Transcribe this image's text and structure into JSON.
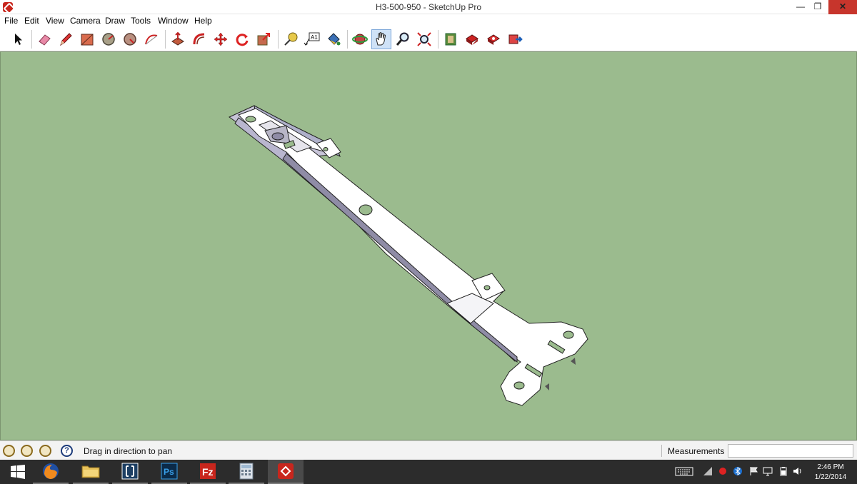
{
  "window": {
    "title": "H3-500-950 - SketchUp Pro",
    "min_glyph": "—",
    "max_glyph": "❐",
    "close_glyph": "✕"
  },
  "menu": [
    "File",
    "Edit",
    "View",
    "Camera",
    "Draw",
    "Tools",
    "Window",
    "Help"
  ],
  "toolbar": {
    "active_tool": "pan-icon",
    "dimension_tool_text": "A1",
    "tools": [
      "select-icon",
      "eraser-icon",
      "pencil-icon",
      "rectangle-icon",
      "circle-icon",
      "polygon-icon",
      "arc-icon",
      "push-pull-icon",
      "follow-me-icon",
      "move-icon",
      "rotate-icon",
      "scale-icon",
      "tape-measure-icon",
      "dimension-text-icon",
      "paint-bucket-icon",
      "orbit-icon",
      "pan-icon",
      "zoom-icon",
      "zoom-extents-icon",
      "3d-warehouse-icon",
      "share-model-icon",
      "get-models-icon",
      "extension-warehouse-icon"
    ]
  },
  "viewport": {
    "background_color": "#9bbb8e",
    "model": "bracket-model"
  },
  "statusbar": {
    "hint": "Drag in direction to pan",
    "measurements_label": "Measurements",
    "measurements_value": "",
    "icons": [
      "geo-location-icon",
      "credits-icon",
      "sign-in-icon",
      "help-icon"
    ]
  },
  "taskbar": {
    "apps": [
      "windows-start-icon",
      "firefox-icon",
      "file-explorer-icon",
      "app-icon",
      "photoshop-icon",
      "filezilla-icon",
      "calculator-icon",
      "sketchup-icon"
    ],
    "photoshop_label": "Ps",
    "filezilla_label": "Fz",
    "tray_icons": [
      "keyboard-icon",
      "network-icon",
      "record-icon",
      "bluetooth-icon",
      "flag-icon",
      "monitor-icon",
      "power-icon",
      "volume-icon"
    ],
    "time": "2:46 PM",
    "date": "1/22/2014"
  }
}
